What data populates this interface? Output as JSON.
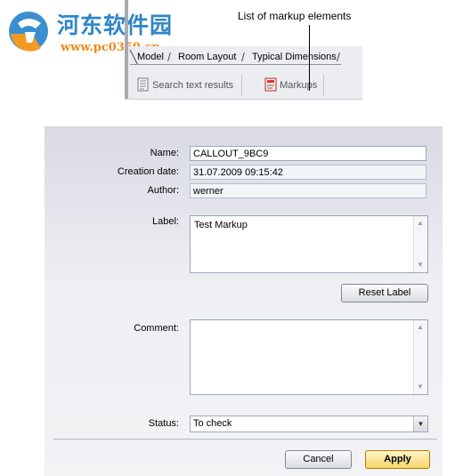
{
  "watermark": {
    "site_name": "河东软件园",
    "site_url": "www.pc0359.cn"
  },
  "callout": {
    "text": "List of markup elements"
  },
  "tabs": [
    {
      "label": "Model"
    },
    {
      "label": "Room Layout"
    },
    {
      "label": "Typical Dimensions"
    }
  ],
  "commands": {
    "search_label": "Search text results",
    "search_icon": "document-search-icon",
    "markups_label": "Markups",
    "markups_icon": "markup-list-icon"
  },
  "form": {
    "name_label": "Name:",
    "name_value": "CALLOUT_9BC9",
    "creation_label": "Creation date:",
    "creation_value": "31.07.2009 09:15:42",
    "author_label": "Author:",
    "author_value": "werner",
    "label_label": "Label:",
    "label_value": "Test Markup",
    "reset_label": "Reset Label",
    "comment_label": "Comment:",
    "comment_value": "",
    "status_label": "Status:",
    "status_value": "To check"
  },
  "buttons": {
    "cancel": "Cancel",
    "apply": "Apply"
  },
  "colors": {
    "watermark_blue": "#2f86c8",
    "watermark_orange": "#f08a1c",
    "apply_accent": "#f7d56a"
  }
}
